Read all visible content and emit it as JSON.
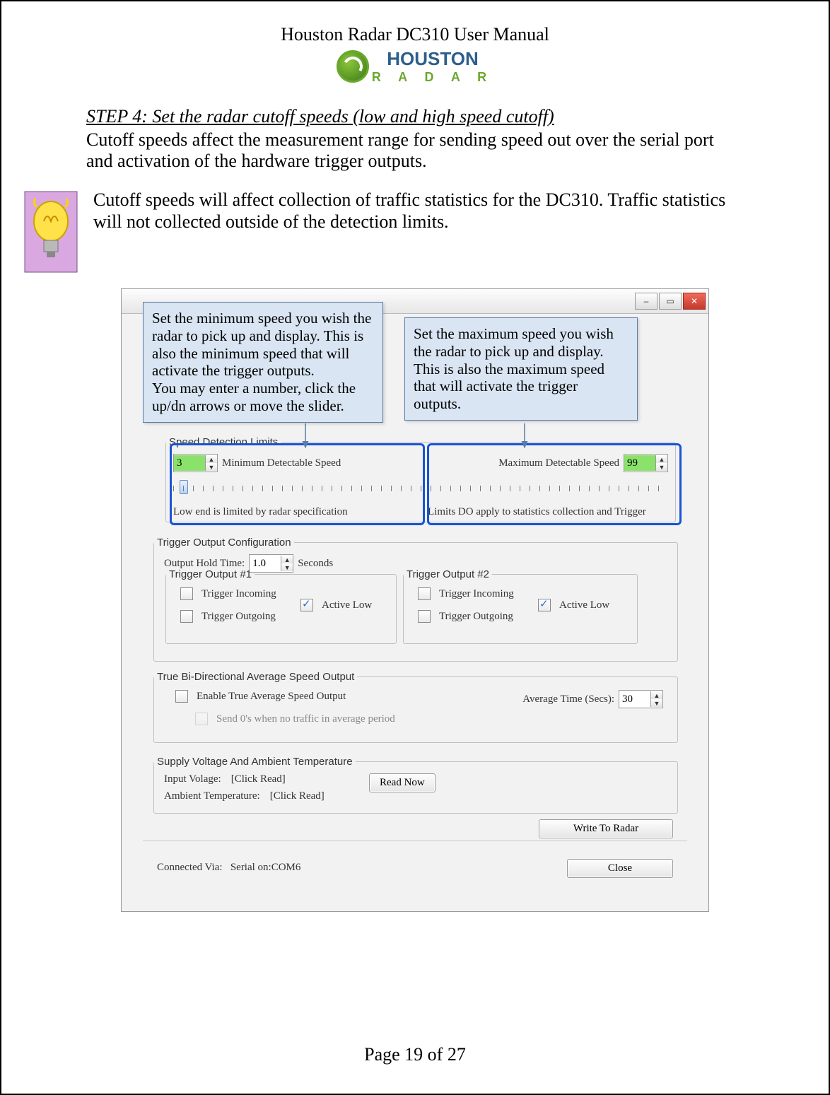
{
  "header": {
    "title": "Houston Radar DC310 User Manual",
    "logo_line1": "HOUSTON",
    "logo_line2": "R A D A R"
  },
  "step_heading": "STEP 4: Set the radar cutoff speeds (low and high speed cutoff)",
  "para1": "Cutoff speeds affect the measurement range for sending speed out over the serial port and activation of the hardware trigger outputs.",
  "para2": "Cutoff speeds will affect collection of traffic statistics for the DC310. Traffic statistics will not collected outside of the detection limits.",
  "callout1": "Set the minimum speed you wish the radar to pick up and display. This is also the minimum speed that will activate the trigger outputs.\nYou may enter a number, click the up/dn arrows or move the slider.",
  "callout2": "Set the maximum speed you wish the radar to pick up and display. This is also the maximum speed that will activate the trigger outputs.",
  "window": {
    "min_button": "–",
    "max_button": "▭",
    "close_button": "✕"
  },
  "speed_limits": {
    "legend": "Speed Detection Limits",
    "min_label": "Minimum Detectable Speed",
    "min_value": "3",
    "max_label": "Maximum Detectable Speed",
    "max_value": "99",
    "low_note": "Low end is limited by radar specification",
    "apply_note": "Limits DO apply to statistics collection and Trigger"
  },
  "trigger": {
    "legend": "Trigger Output Configuration",
    "hold_label": "Output Hold Time:",
    "hold_value": "1.0",
    "hold_unit": "Seconds",
    "t1_legend": "Trigger Output #1",
    "t2_legend": "Trigger Output #2",
    "incoming": "Trigger Incoming",
    "outgoing": "Trigger Outgoing",
    "active_low": "Active Low"
  },
  "bidir": {
    "legend": "True Bi-Directional Average Speed Output",
    "enable": "Enable True Average Speed Output",
    "send_zeros": "Send 0's when no traffic in average period",
    "avg_label": "Average Time (Secs):",
    "avg_value": "30"
  },
  "supply": {
    "legend": "Supply Voltage And Ambient Temperature",
    "voltage_label": "Input Volage:",
    "voltage_value": "[Click Read]",
    "temp_label": "Ambient Temperature:",
    "temp_value": "[Click Read]",
    "read_btn": "Read Now"
  },
  "buttons": {
    "write": "Write To  Radar",
    "close": "Close"
  },
  "status": {
    "connected_label": "Connected Via:",
    "connected_value": "Serial on:COM6"
  },
  "footer": "Page 19 of 27"
}
